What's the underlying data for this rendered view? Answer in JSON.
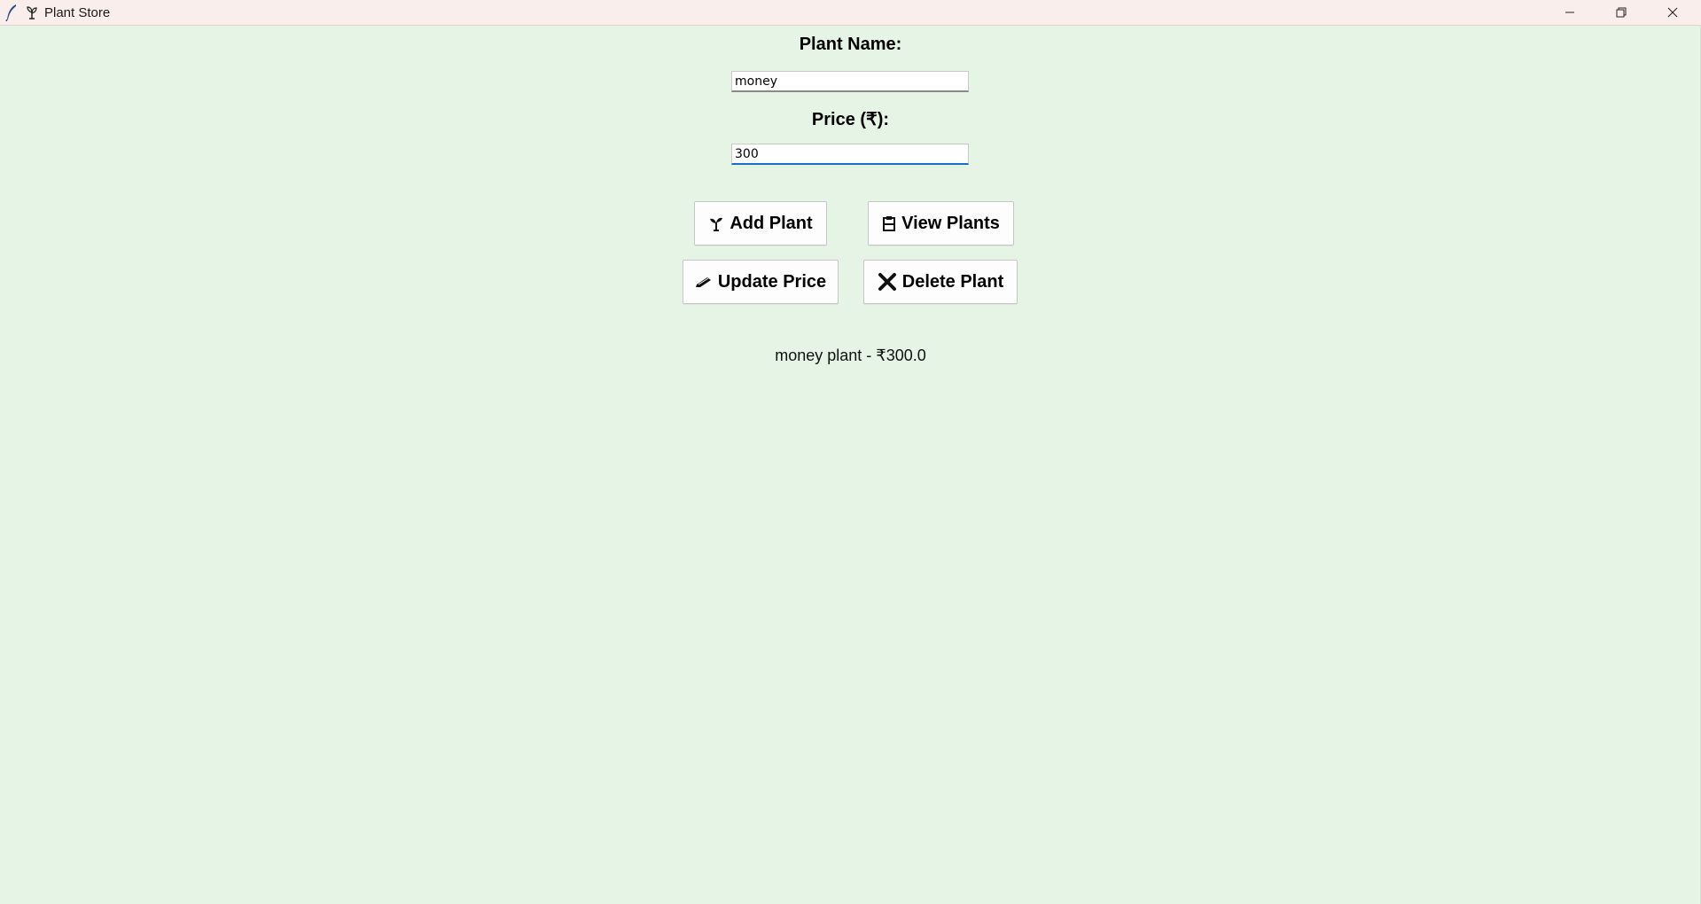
{
  "window": {
    "title": "Plant Store",
    "controls": [
      "minimize",
      "restore",
      "close"
    ]
  },
  "form": {
    "name_label": "Plant Name:",
    "name_value": "money",
    "price_label": "Price (₹):",
    "price_value": "300"
  },
  "buttons": {
    "add": {
      "label": "Add Plant",
      "icon": "seedling-icon"
    },
    "view": {
      "label": "View Plants",
      "icon": "clipboard-icon"
    },
    "update": {
      "label": "Update Price",
      "icon": "pencil-icon"
    },
    "delete": {
      "label": "Delete Plant",
      "icon": "cross-icon"
    }
  },
  "result": {
    "text": "money plant - ₹300.0"
  },
  "colors": {
    "background": "#e6f4e6",
    "titlebar": "#f9eeeb",
    "focus_accent": "#1a6fc2"
  }
}
